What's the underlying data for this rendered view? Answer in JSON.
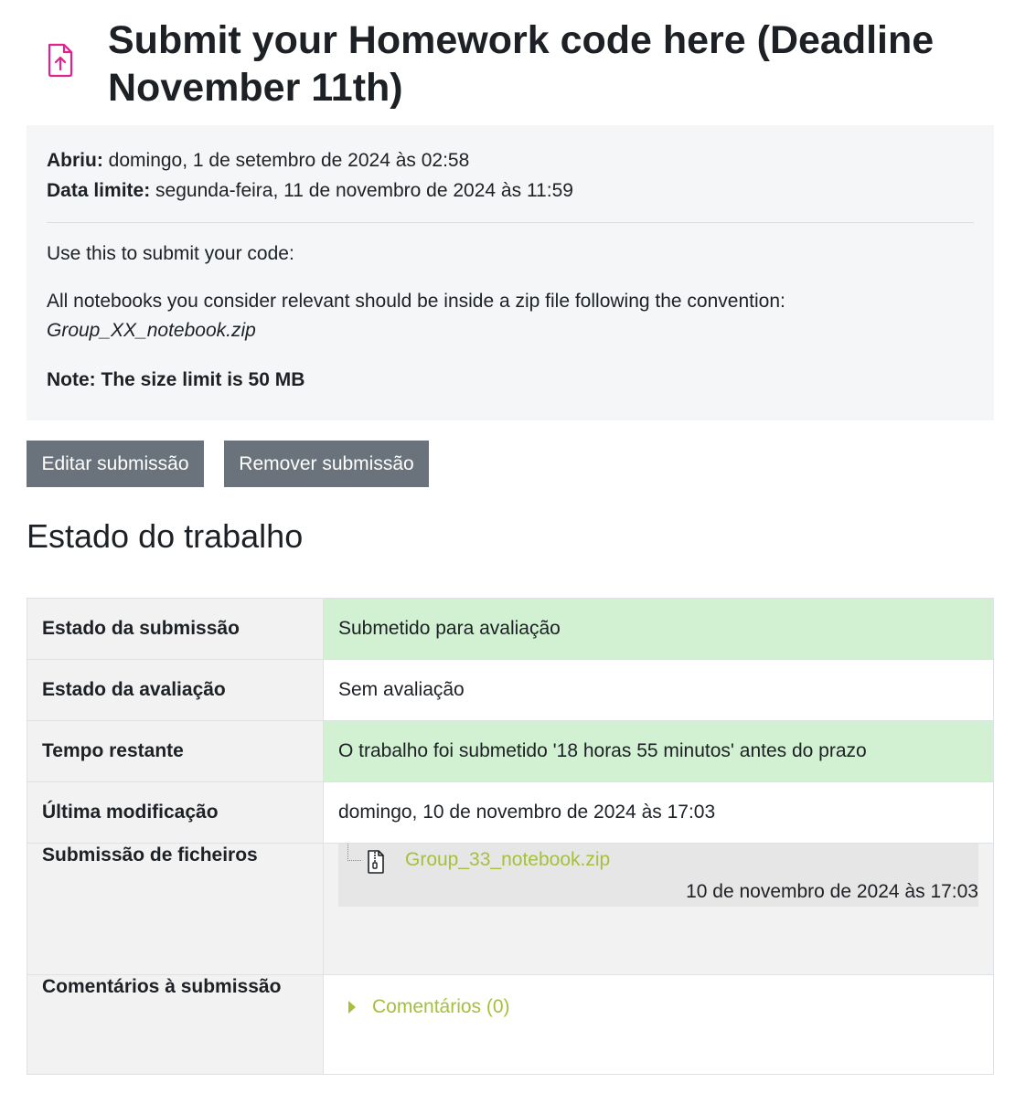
{
  "page": {
    "title": "Submit your Homework code here (Deadline November 11th)",
    "icon": "file-upload-icon"
  },
  "dates": {
    "opened_label": "Abriu:",
    "opened_value": "domingo, 1 de setembro de 2024 às 02:58",
    "due_label": "Data limite:",
    "due_value": "segunda-feira, 11 de novembro de 2024 às 11:59"
  },
  "description": {
    "intro": "Use this to submit your code:",
    "convention": "All notebooks you consider relevant should be inside a zip file following the convention:",
    "filename": "Group_XX_notebook.zip",
    "note": "Note: The size limit is 50 MB"
  },
  "actions": {
    "edit": "Editar submissão",
    "remove": "Remover submissão"
  },
  "status_section": {
    "heading": "Estado do trabalho",
    "rows": [
      {
        "label": "Estado da submissão",
        "value": "Submetido para avaliação"
      },
      {
        "label": "Estado da avaliação",
        "value": "Sem avaliação"
      },
      {
        "label": "Tempo restante",
        "value": "O trabalho foi submetido '18 horas 55 minutos' antes do prazo"
      },
      {
        "label": "Última modificação",
        "value": "domingo, 10 de novembro de 2024 às 17:03"
      },
      {
        "label": "Submissão de ficheiros",
        "file_name": "Group_33_notebook.zip",
        "file_date": "10 de novembro de 2024 às 17:03",
        "file_icon": "zip-file-icon"
      },
      {
        "label": "Comentários à submissão",
        "comments_link": "Comentários (0)"
      }
    ]
  },
  "colors": {
    "success_bg": "#d2f0d2",
    "button_bg": "#6a737b",
    "link": "#a5c03c",
    "icon_accent": "#e0228c"
  }
}
